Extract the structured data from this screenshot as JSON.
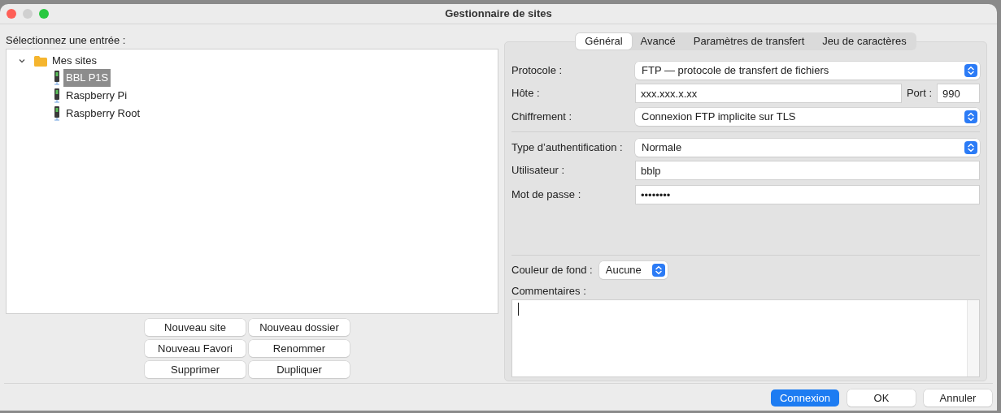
{
  "window": {
    "title": "Gestionnaire de sites"
  },
  "tree": {
    "label": "Sélectionnez une entrée :",
    "root": {
      "label": "Mes sites",
      "expanded": true,
      "children": [
        {
          "label": "BBL P1S",
          "selected": true
        },
        {
          "label": "Raspberry Pi",
          "selected": false
        },
        {
          "label": "Raspberry Root",
          "selected": false
        }
      ]
    }
  },
  "site_buttons": [
    "Nouveau site",
    "Nouveau dossier",
    "Nouveau Favori",
    "Renommer",
    "Supprimer",
    "Dupliquer"
  ],
  "tabs": [
    {
      "label": "Général",
      "selected": true
    },
    {
      "label": "Avancé",
      "selected": false
    },
    {
      "label": "Paramètres de transfert",
      "selected": false
    },
    {
      "label": "Jeu de caractères",
      "selected": false
    }
  ],
  "form": {
    "protocol": {
      "label": "Protocole :",
      "value": "FTP — protocole de transfert de fichiers"
    },
    "host": {
      "label": "Hôte :",
      "value": "xxx.xxx.x.xx"
    },
    "port": {
      "label": "Port :",
      "value": "990"
    },
    "encryption": {
      "label": "Chiffrement :",
      "value": "Connexion FTP implicite sur TLS"
    },
    "auth_type": {
      "label": "Type d’authentification :",
      "value": "Normale"
    },
    "user": {
      "label": "Utilisateur :",
      "value": "bblp"
    },
    "password": {
      "label": "Mot de passe :",
      "value": "••••••••"
    },
    "background_color": {
      "label": "Couleur de fond :",
      "value": "Aucune"
    },
    "comments": {
      "label": "Commentaires :"
    }
  },
  "footer_buttons": [
    {
      "label": "Connexion",
      "kind": "primary"
    },
    {
      "label": "OK",
      "kind": "normal"
    },
    {
      "label": "Annuler",
      "kind": "normal"
    }
  ]
}
